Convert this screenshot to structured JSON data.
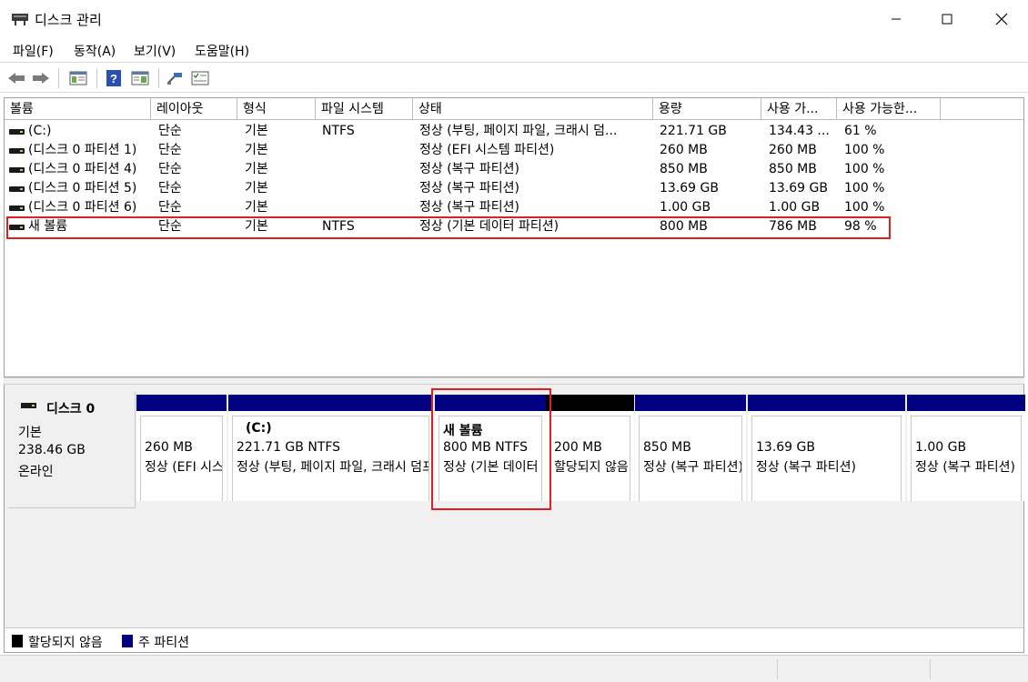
{
  "window": {
    "title": "디스크 관리"
  },
  "menu": [
    {
      "label": "파일(F)"
    },
    {
      "label": "동작(A)"
    },
    {
      "label": "보기(V)"
    },
    {
      "label": "도움말(H)"
    }
  ],
  "toolbar": [
    {
      "icon": "back-arrow-icon"
    },
    {
      "icon": "forward-arrow-icon"
    },
    {
      "icon": "console-tree-icon"
    },
    {
      "icon": "help-icon"
    },
    {
      "icon": "properties-icon"
    },
    {
      "icon": "connect-icon"
    },
    {
      "icon": "checklist-icon"
    }
  ],
  "columns": [
    "볼륨",
    "레이아웃",
    "형식",
    "파일 시스템",
    "상태",
    "용량",
    "사용 가...",
    "사용 가능한..."
  ],
  "volumes": [
    {
      "name": "(C:)",
      "layout": "단순",
      "type": "기본",
      "fs": "NTFS",
      "status": "정상 (부팅, 페이지 파일, 크래시 덤...",
      "capacity": "221.71 GB",
      "free": "134.43 ...",
      "pct": "61 %"
    },
    {
      "name": "(디스크 0 파티션 1)",
      "layout": "단순",
      "type": "기본",
      "fs": "",
      "status": "정상 (EFI 시스템 파티션)",
      "capacity": "260 MB",
      "free": "260 MB",
      "pct": "100 %"
    },
    {
      "name": "(디스크 0 파티션 4)",
      "layout": "단순",
      "type": "기본",
      "fs": "",
      "status": "정상 (복구 파티션)",
      "capacity": "850 MB",
      "free": "850 MB",
      "pct": "100 %"
    },
    {
      "name": "(디스크 0 파티션 5)",
      "layout": "단순",
      "type": "기본",
      "fs": "",
      "status": "정상 (복구 파티션)",
      "capacity": "13.69 GB",
      "free": "13.69 GB",
      "pct": "100 %"
    },
    {
      "name": "(디스크 0 파티션 6)",
      "layout": "단순",
      "type": "기본",
      "fs": "",
      "status": "정상 (복구 파티션)",
      "capacity": "1.00 GB",
      "free": "1.00 GB",
      "pct": "100 %"
    },
    {
      "name": "새 볼륨",
      "layout": "단순",
      "type": "기본",
      "fs": "NTFS",
      "status": "정상 (기본 데이터 파티션)",
      "capacity": "800 MB",
      "free": "786 MB",
      "pct": "98 %"
    }
  ],
  "disk": {
    "name": "디스크 0",
    "type": "기본",
    "size": "238.46 GB",
    "state": "온라인"
  },
  "partitions": [
    {
      "name": "",
      "line1": "260 MB",
      "line2": "정상 (EFI 시스템 파티션)",
      "bar": "#000080"
    },
    {
      "name": "(C:)",
      "line1": "221.71 GB NTFS",
      "line2": "정상 (부팅, 페이지 파일, 크래시 덤프, 기본 데이터 파티션)",
      "bar": "#000080"
    },
    {
      "name": "새 볼륨",
      "line1": "800 MB NTFS",
      "line2": "정상 (기본 데이터 파티션)",
      "bar": "#000080"
    },
    {
      "name": "",
      "line1": "200 MB",
      "line2": "할당되지 않음",
      "bar": "#000000"
    },
    {
      "name": "",
      "line1": "850 MB",
      "line2": "정상 (복구 파티션)",
      "bar": "#000080"
    },
    {
      "name": "",
      "line1": "13.69 GB",
      "line2": "정상 (복구 파티션)",
      "bar": "#000080"
    },
    {
      "name": "",
      "line1": "1.00 GB",
      "line2": "정상 (복구 파티션)",
      "bar": "#000080"
    }
  ],
  "legend": [
    {
      "label": "할당되지 않음",
      "color": "#000000"
    },
    {
      "label": "주 파티션",
      "color": "#000080"
    }
  ],
  "colors": {
    "highlight": "#e02020",
    "primary_partition": "#000080",
    "unallocated": "#000000"
  }
}
